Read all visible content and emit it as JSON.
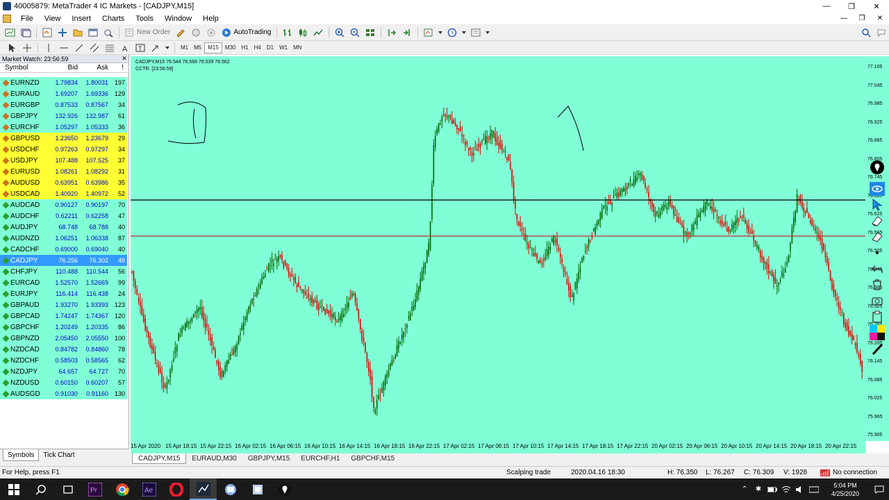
{
  "window": {
    "title": "40005879: MetaTrader 4 IC Markets - [CADJPY,M15]"
  },
  "menu": [
    "File",
    "View",
    "Insert",
    "Charts",
    "Tools",
    "Window",
    "Help"
  ],
  "toolbar": {
    "new_order": "New Order",
    "auto_trading": "AutoTrading",
    "timeframes": [
      "M1",
      "M5",
      "M15",
      "M30",
      "H1",
      "H4",
      "D1",
      "W1",
      "MN"
    ],
    "active_timeframe": "M15"
  },
  "market_watch": {
    "header": "Market Watch: 23:56:59",
    "columns": {
      "symbol": "Symbol",
      "bid": "Bid",
      "ask": "Ask",
      "spread": "!"
    },
    "rows": [
      {
        "symbol": "EURNZD",
        "bid": "1.79834",
        "ask": "1.80031",
        "spread": "197",
        "bg": "#80ffd6",
        "icon": "#d07020"
      },
      {
        "symbol": "EURAUD",
        "bid": "1.69207",
        "ask": "1.69336",
        "spread": "129",
        "bg": "#80ffd6",
        "icon": "#d07020"
      },
      {
        "symbol": "EURGBP",
        "bid": "0.87533",
        "ask": "0.87567",
        "spread": "34",
        "bg": "#80ffd6",
        "icon": "#d07020"
      },
      {
        "symbol": "GBPJPY",
        "bid": "132.926",
        "ask": "132.987",
        "spread": "61",
        "bg": "#80ffd6",
        "icon": "#d07020"
      },
      {
        "symbol": "EURCHF",
        "bid": "1.05297",
        "ask": "1.05333",
        "spread": "36",
        "bg": "#80ffd6",
        "icon": "#d07020"
      },
      {
        "symbol": "GBPUSD",
        "bid": "1.23650",
        "ask": "1.23679",
        "spread": "29",
        "bg": "#ffff33",
        "icon": "#d07020"
      },
      {
        "symbol": "USDCHF",
        "bid": "0.97263",
        "ask": "0.97297",
        "spread": "34",
        "bg": "#ffff33",
        "icon": "#d07020"
      },
      {
        "symbol": "USDJPY",
        "bid": "107.488",
        "ask": "107.525",
        "spread": "37",
        "bg": "#ffff33",
        "icon": "#d07020"
      },
      {
        "symbol": "EURUSD",
        "bid": "1.08261",
        "ask": "1.08292",
        "spread": "31",
        "bg": "#ffff33",
        "icon": "#d07020"
      },
      {
        "symbol": "AUDUSD",
        "bid": "0.63951",
        "ask": "0.63986",
        "spread": "35",
        "bg": "#ffff33",
        "icon": "#d07020"
      },
      {
        "symbol": "USDCAD",
        "bid": "1.40920",
        "ask": "1.40972",
        "spread": "52",
        "bg": "#ffff33",
        "icon": "#d07020"
      },
      {
        "symbol": "AUDCAD",
        "bid": "0.90127",
        "ask": "0.90197",
        "spread": "70",
        "bg": "#80ffd6",
        "icon": "#2aa02a"
      },
      {
        "symbol": "AUDCHF",
        "bid": "0.62211",
        "ask": "0.62258",
        "spread": "47",
        "bg": "#80ffd6",
        "icon": "#2aa02a"
      },
      {
        "symbol": "AUDJPY",
        "bid": "68.748",
        "ask": "68.788",
        "spread": "40",
        "bg": "#80ffd6",
        "icon": "#2aa02a"
      },
      {
        "symbol": "AUDNZD",
        "bid": "1.06251",
        "ask": "1.06338",
        "spread": "87",
        "bg": "#80ffd6",
        "icon": "#2aa02a"
      },
      {
        "symbol": "CADCHF",
        "bid": "0.69000",
        "ask": "0.69040",
        "spread": "40",
        "bg": "#80ffd6",
        "icon": "#2aa02a"
      },
      {
        "symbol": "CADJPY",
        "bid": "76.256",
        "ask": "76.302",
        "spread": "46",
        "bg": "#3399ff",
        "icon": "#2aa02a",
        "selected": true
      },
      {
        "symbol": "CHFJPY",
        "bid": "110.488",
        "ask": "110.544",
        "spread": "56",
        "bg": "#80ffd6",
        "icon": "#2aa02a"
      },
      {
        "symbol": "EURCAD",
        "bid": "1.52570",
        "ask": "1.52669",
        "spread": "99",
        "bg": "#80ffd6",
        "icon": "#2aa02a"
      },
      {
        "symbol": "EURJPY",
        "bid": "116.414",
        "ask": "116.438",
        "spread": "24",
        "bg": "#80ffd6",
        "icon": "#2aa02a"
      },
      {
        "symbol": "GBPAUD",
        "bid": "1.93270",
        "ask": "1.93393",
        "spread": "123",
        "bg": "#80ffd6",
        "icon": "#2aa02a"
      },
      {
        "symbol": "GBPCAD",
        "bid": "1.74247",
        "ask": "1.74367",
        "spread": "120",
        "bg": "#80ffd6",
        "icon": "#2aa02a"
      },
      {
        "symbol": "GBPCHF",
        "bid": "1.20249",
        "ask": "1.20335",
        "spread": "86",
        "bg": "#80ffd6",
        "icon": "#2aa02a"
      },
      {
        "symbol": "GBPNZD",
        "bid": "2.05450",
        "ask": "2.05550",
        "spread": "100",
        "bg": "#80ffd6",
        "icon": "#2aa02a"
      },
      {
        "symbol": "NZDCAD",
        "bid": "0.84782",
        "ask": "0.84860",
        "spread": "78",
        "bg": "#80ffd6",
        "icon": "#2aa02a"
      },
      {
        "symbol": "NZDCHF",
        "bid": "0.58503",
        "ask": "0.58565",
        "spread": "62",
        "bg": "#80ffd6",
        "icon": "#2aa02a"
      },
      {
        "symbol": "NZDJPY",
        "bid": "64.657",
        "ask": "64.727",
        "spread": "70",
        "bg": "#80ffd6",
        "icon": "#2aa02a"
      },
      {
        "symbol": "NZDUSD",
        "bid": "0.60150",
        "ask": "0.60207",
        "spread": "57",
        "bg": "#80ffd6",
        "icon": "#2aa02a"
      },
      {
        "symbol": "AUDSGD",
        "bid": "0.91030",
        "ask": "0.91160",
        "spread": "130",
        "bg": "#80ffd6",
        "icon": "#2aa02a"
      }
    ],
    "tabs": [
      "Symbols",
      "Tick Chart"
    ]
  },
  "chart": {
    "info_line1": "CADJPY,M15  76.544 76.568 76.539 76.562",
    "info_line2": "CCTR: [23:56:59]",
    "background": "#80ffd6",
    "price_ticks": [
      "77.105",
      "77.045",
      "76.985",
      "76.925",
      "76.865",
      "76.805",
      "76.745",
      "76.685",
      "76.625",
      "76.565",
      "76.505",
      "76.445",
      "76.385",
      "76.325",
      "76.265",
      "76.205",
      "76.145",
      "76.085",
      "76.025",
      "75.965",
      "75.905"
    ],
    "time_labels": [
      "15 Apr 2020",
      "15 Apr 18:15",
      "15 Apr 22:15",
      "16 Apr 02:15",
      "16 Apr 06:15",
      "16 Apr 10:15",
      "16 Apr 14:15",
      "16 Apr 18:15",
      "16 Apr 22:15",
      "17 Apr 02:15",
      "17 Apr 06:15",
      "17 Apr 10:15",
      "17 Apr 14:15",
      "17 Apr 18:15",
      "17 Apr 22:15",
      "20 Apr 02:15",
      "20 Apr 06:15",
      "20 Apr 10:15",
      "20 Apr 14:15",
      "20 Apr 18:15",
      "20 Apr 22:15"
    ]
  },
  "chart_tabs": [
    "CADJPY,M15",
    "EURAUD,M30",
    "GBPJPY,M15",
    "EURCHF,H1",
    "GBPCHF,M15"
  ],
  "status": {
    "help": "For Help, press F1",
    "profile": "Scalping trade",
    "datetime": "2020.04.16 18:30",
    "high": "H: 76.350",
    "low": "L: 76.267",
    "close": "C: 76.309",
    "volume": "V: 1928",
    "connection": "No connection"
  },
  "taskbar": {
    "time": "5:04 PM",
    "date": "4/25/2020"
  }
}
